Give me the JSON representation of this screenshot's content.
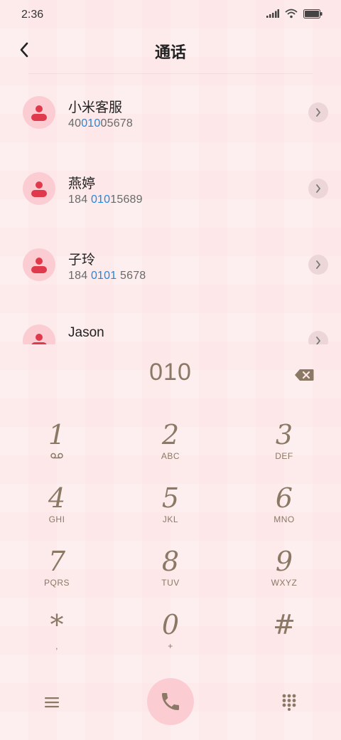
{
  "status": {
    "time": "2:36",
    "icons": [
      "signal-icon",
      "wifi-icon",
      "battery-icon"
    ]
  },
  "header": {
    "title": "通话"
  },
  "results": [
    {
      "name": "小米客服",
      "number_pre": "40",
      "number_match": "010",
      "number_post": "05678"
    },
    {
      "name": "燕婷",
      "number_pre": "184 ",
      "number_match": "010",
      "number_post": "15689"
    },
    {
      "name": "子玲",
      "number_pre": "184 ",
      "number_match": "0101",
      "number_post": " 5678"
    },
    {
      "name": "Jason",
      "number_pre": "",
      "number_match": "",
      "number_post": ""
    }
  ],
  "dial": {
    "digits": "010"
  },
  "keypad": {
    "k1": {
      "digit": "1",
      "letters": ""
    },
    "k2": {
      "digit": "2",
      "letters": "ABC"
    },
    "k3": {
      "digit": "3",
      "letters": "DEF"
    },
    "k4": {
      "digit": "4",
      "letters": "GHI"
    },
    "k5": {
      "digit": "5",
      "letters": "JKL"
    },
    "k6": {
      "digit": "6",
      "letters": "MNO"
    },
    "k7": {
      "digit": "7",
      "letters": "PQRS"
    },
    "k8": {
      "digit": "8",
      "letters": "TUV"
    },
    "k9": {
      "digit": "9",
      "letters": "WXYZ"
    },
    "kstar": {
      "digit": "*",
      "letters": ","
    },
    "k0": {
      "digit": "0",
      "letters": "+"
    },
    "khash": {
      "digit": "#",
      "letters": ""
    }
  },
  "colors": {
    "accent": "#8b7865",
    "highlight": "#1e88e5",
    "avatar_bg": "#fbcdd3",
    "avatar_fg": "#e0394b",
    "background": "#fde7e8"
  }
}
